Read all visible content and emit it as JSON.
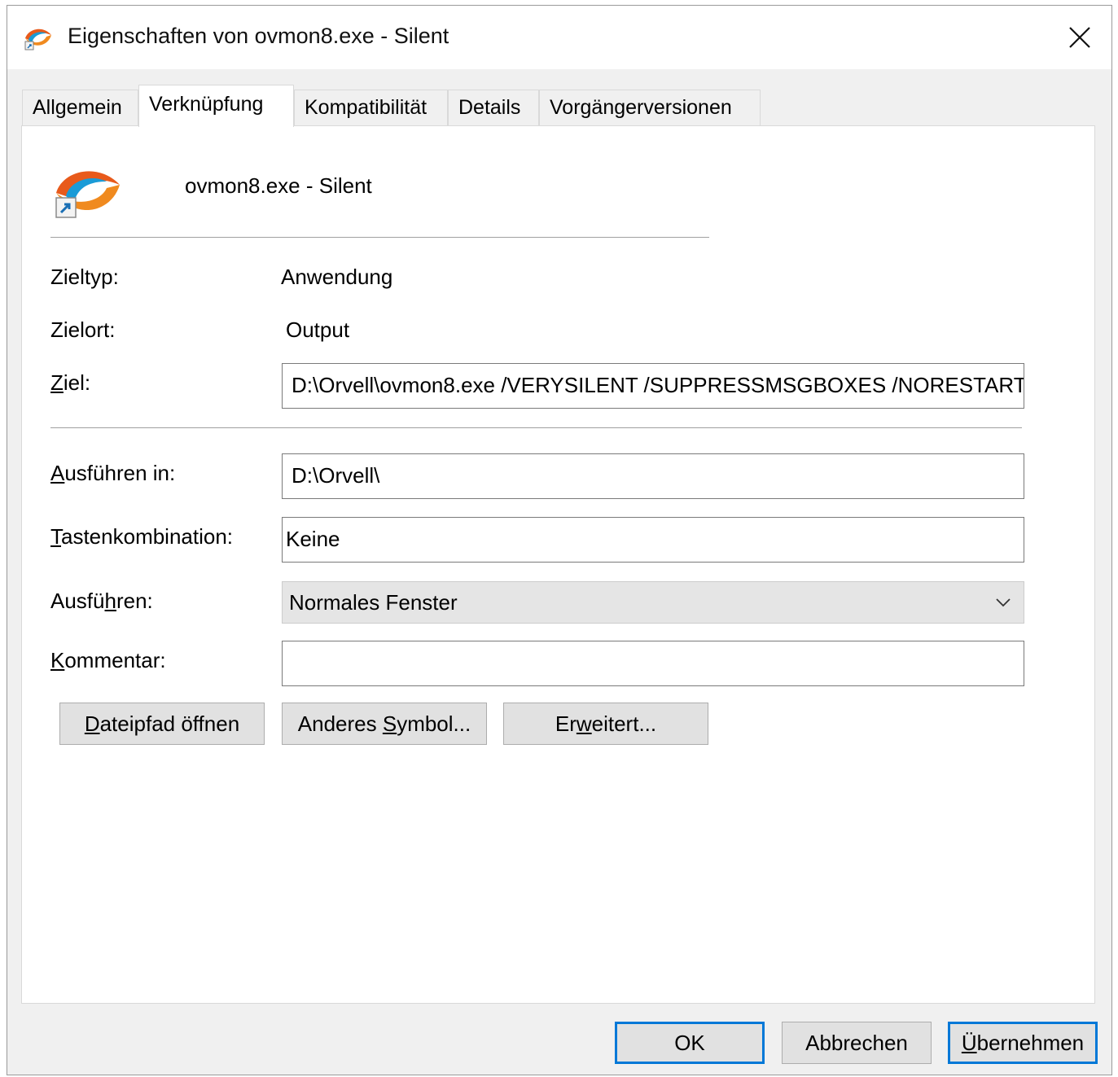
{
  "window": {
    "title": "Eigenschaften von ovmon8.exe - Silent",
    "close_icon": "close-icon"
  },
  "tabs": [
    {
      "label": "Allgemein",
      "active": false
    },
    {
      "label": "Verknüpfung",
      "active": true
    },
    {
      "label": "Kompatibilität",
      "active": false
    },
    {
      "label": "Details",
      "active": false
    },
    {
      "label": "Vorgängerversionen",
      "active": false
    }
  ],
  "shortcut": {
    "name": "ovmon8.exe - Silent",
    "icon": "ovmon-shortcut-icon"
  },
  "fields": {
    "zieltyp": {
      "label": "Zieltyp:",
      "value": "Anwendung"
    },
    "zielort": {
      "label": "Zielort:",
      "value": "Output"
    },
    "ziel": {
      "label_pre": "",
      "label_accel": "Z",
      "label_post": "iel:",
      "value": "D:\\Orvell\\ovmon8.exe /VERYSILENT /SUPPRESSMSGBOXES /NORESTART"
    },
    "ausfuehren_in": {
      "label_pre": "",
      "label_accel": "A",
      "label_post": "usführen in:",
      "value": "D:\\Orvell\\"
    },
    "tastenkombination": {
      "label_pre": "",
      "label_accel": "T",
      "label_post": "astenkombination:",
      "value": "Keine"
    },
    "ausfuehren": {
      "label_pre": "Ausfü",
      "label_accel": "h",
      "label_post": "ren:",
      "value": "Normales Fenster"
    },
    "kommentar": {
      "label_pre": "",
      "label_accel": "K",
      "label_post": "ommentar:",
      "value": ""
    }
  },
  "action_buttons": {
    "open_path": {
      "pre": "",
      "accel": "D",
      "post": "ateipfad öffnen"
    },
    "change_icon": {
      "pre": "Anderes ",
      "accel": "S",
      "post": "ymbol..."
    },
    "advanced": {
      "pre": "Er",
      "accel": "w",
      "post": "eitert..."
    }
  },
  "dialog_buttons": {
    "ok": "OK",
    "cancel": "Abbrechen",
    "apply": {
      "pre": "",
      "accel": "Ü",
      "post": "bernehmen"
    }
  },
  "colors": {
    "accent": "#0078d7",
    "icon_orange": "#e85a1b",
    "icon_blue": "#1a9bd7"
  }
}
